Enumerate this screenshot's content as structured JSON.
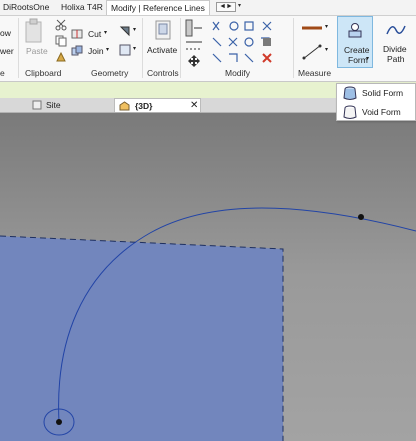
{
  "app_tabs": [
    "DiRootsOne",
    "Holixa T4R",
    "Modify | Reference Lines"
  ],
  "ribbon": {
    "left_partial": [
      "ow",
      "wer"
    ],
    "clipboard": {
      "paste": "Paste",
      "cut": "Cut",
      "join": "Join"
    },
    "controls": {
      "activate": "Activate"
    },
    "create_form": {
      "line1": "Create",
      "line2": "Form"
    },
    "divide_path": {
      "line1": "Divide",
      "line2": "Path"
    },
    "panels": [
      "e",
      "Clipboard",
      "Geometry",
      "Controls",
      "Modify",
      "Measure"
    ]
  },
  "create_form_menu": {
    "items": [
      {
        "label": "Solid Form",
        "icon": "solid-form-icon"
      },
      {
        "label": "Void Form",
        "icon": "void-form-icon"
      }
    ]
  },
  "view_tabs": [
    {
      "label": "Site",
      "active": false
    },
    {
      "label": "{3D}",
      "active": true
    }
  ],
  "view_tab_close": "✕",
  "colors": {
    "viewport_bg": "#8a8a8a",
    "surface_fill": "#7286bd",
    "curve": "#1f3a9a",
    "highlight": "#cde6f7",
    "options_bar": "#e7f2cf"
  }
}
